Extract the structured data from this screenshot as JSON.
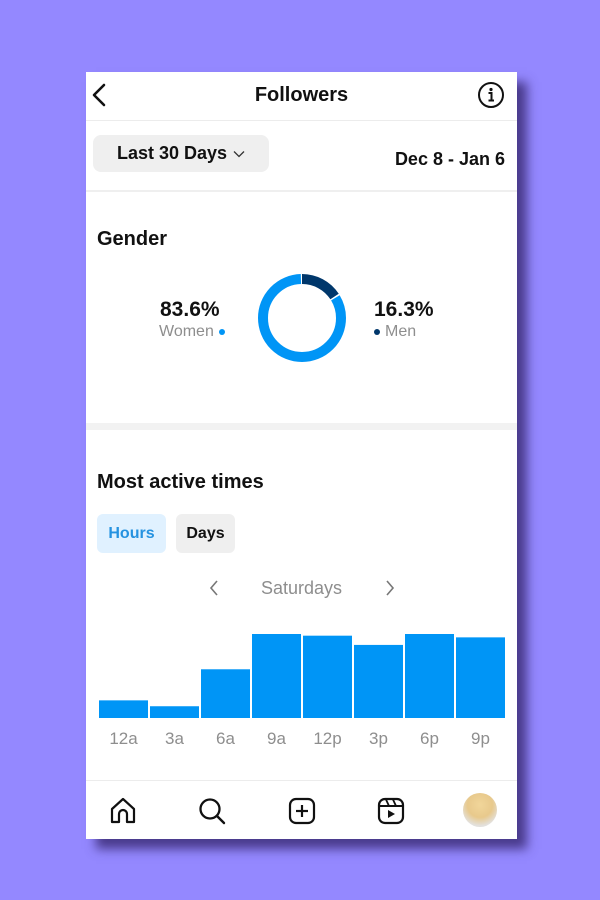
{
  "header": {
    "title": "Followers",
    "back_icon": "chevron-left-icon",
    "info_icon": "info-circle-icon"
  },
  "filter": {
    "range_label": "Last 30 Days",
    "range_icon": "chevron-down-icon",
    "date_range": "Dec 8 - Jan 6"
  },
  "gender": {
    "title": "Gender",
    "women": {
      "percent": "83.6%",
      "label": "Women",
      "value": 83.6,
      "color": "#0095f6"
    },
    "men": {
      "percent": "16.3%",
      "label": "Men",
      "value": 16.3,
      "color": "#00376b"
    }
  },
  "active_times": {
    "title": "Most active times",
    "tabs": [
      {
        "label": "Hours",
        "active": true
      },
      {
        "label": "Days",
        "active": false
      }
    ],
    "day_label": "Saturdays",
    "prev_icon": "chevron-left-icon",
    "next_icon": "chevron-right-icon"
  },
  "chart_data": {
    "type": "bar",
    "title": "Most active times - Saturdays (Hours)",
    "categories": [
      "12a",
      "3a",
      "6a",
      "9a",
      "12p",
      "3p",
      "6p",
      "9p"
    ],
    "values": [
      21,
      14,
      58,
      100,
      98,
      87,
      100,
      96
    ],
    "ylabel": "",
    "xlabel": "",
    "ylim": [
      0,
      100
    ],
    "grid": false,
    "bar_color": "#0095f6"
  },
  "bottom_nav": {
    "items": [
      {
        "name": "home",
        "icon": "home-icon"
      },
      {
        "name": "search",
        "icon": "search-icon"
      },
      {
        "name": "create",
        "icon": "plus-square-icon"
      },
      {
        "name": "reels",
        "icon": "reels-icon"
      },
      {
        "name": "profile",
        "icon": "avatar"
      }
    ]
  }
}
